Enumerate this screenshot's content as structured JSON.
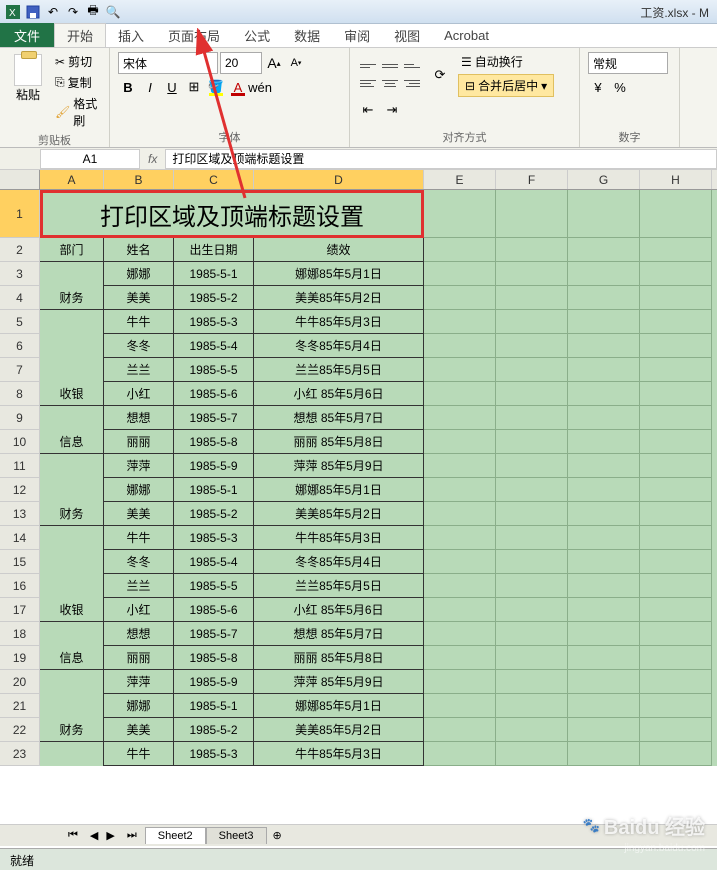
{
  "window": {
    "title": "工资.xlsx - M"
  },
  "qat": {
    "save": "保存",
    "undo": "撤销",
    "redo": "重做"
  },
  "tabs": {
    "file": "文件",
    "items": [
      "开始",
      "插入",
      "页面布局",
      "公式",
      "数据",
      "审阅",
      "视图",
      "Acrobat"
    ],
    "active": 0
  },
  "ribbon": {
    "clipboard": {
      "label": "剪贴板",
      "paste": "粘贴",
      "cut": "剪切",
      "copy": "复制",
      "format": "格式刷"
    },
    "font": {
      "label": "字体",
      "name": "宋体",
      "size": "20",
      "grow": "A",
      "shrink": "A"
    },
    "align": {
      "label": "对齐方式",
      "wrap": "自动换行",
      "merge": "合并后居中"
    },
    "number": {
      "label": "数字",
      "format": "常规"
    }
  },
  "cellref": {
    "name": "A1",
    "formula": "打印区域及顶端标题设置"
  },
  "columns": [
    "A",
    "B",
    "C",
    "D",
    "E",
    "F",
    "G",
    "H"
  ],
  "sheet": {
    "title": "打印区域及顶端标题设置",
    "headers": [
      "部门",
      "姓名",
      "出生日期",
      "绩效"
    ],
    "rows": [
      {
        "n": 3,
        "a": "",
        "b": "娜娜",
        "c": "1985-5-1",
        "d": "娜娜85年5月1日"
      },
      {
        "n": 4,
        "a": "财务",
        "b": "美美",
        "c": "1985-5-2",
        "d": "美美85年5月2日"
      },
      {
        "n": 5,
        "a": "",
        "b": "牛牛",
        "c": "1985-5-3",
        "d": "牛牛85年5月3日"
      },
      {
        "n": 6,
        "a": "",
        "b": "冬冬",
        "c": "1985-5-4",
        "d": "冬冬85年5月4日"
      },
      {
        "n": 7,
        "a": "",
        "b": "兰兰",
        "c": "1985-5-5",
        "d": "兰兰85年5月5日"
      },
      {
        "n": 8,
        "a": "收银",
        "b": "小红",
        "c": "1985-5-6",
        "d": "小红 85年5月6日"
      },
      {
        "n": 9,
        "a": "",
        "b": "想想",
        "c": "1985-5-7",
        "d": "想想 85年5月7日"
      },
      {
        "n": 10,
        "a": "信息",
        "b": "丽丽",
        "c": "1985-5-8",
        "d": "丽丽 85年5月8日"
      },
      {
        "n": 11,
        "a": "",
        "b": "萍萍",
        "c": "1985-5-9",
        "d": "萍萍 85年5月9日"
      },
      {
        "n": 12,
        "a": "",
        "b": "娜娜",
        "c": "1985-5-1",
        "d": "娜娜85年5月1日"
      },
      {
        "n": 13,
        "a": "财务",
        "b": "美美",
        "c": "1985-5-2",
        "d": "美美85年5月2日"
      },
      {
        "n": 14,
        "a": "",
        "b": "牛牛",
        "c": "1985-5-3",
        "d": "牛牛85年5月3日"
      },
      {
        "n": 15,
        "a": "",
        "b": "冬冬",
        "c": "1985-5-4",
        "d": "冬冬85年5月4日"
      },
      {
        "n": 16,
        "a": "",
        "b": "兰兰",
        "c": "1985-5-5",
        "d": "兰兰85年5月5日"
      },
      {
        "n": 17,
        "a": "收银",
        "b": "小红",
        "c": "1985-5-6",
        "d": "小红 85年5月6日"
      },
      {
        "n": 18,
        "a": "",
        "b": "想想",
        "c": "1985-5-7",
        "d": "想想 85年5月7日"
      },
      {
        "n": 19,
        "a": "信息",
        "b": "丽丽",
        "c": "1985-5-8",
        "d": "丽丽 85年5月8日"
      },
      {
        "n": 20,
        "a": "",
        "b": "萍萍",
        "c": "1985-5-9",
        "d": "萍萍 85年5月9日"
      },
      {
        "n": 21,
        "a": "",
        "b": "娜娜",
        "c": "1985-5-1",
        "d": "娜娜85年5月1日"
      },
      {
        "n": 22,
        "a": "财务",
        "b": "美美",
        "c": "1985-5-2",
        "d": "美美85年5月2日"
      },
      {
        "n": 23,
        "a": "",
        "b": "牛牛",
        "c": "1985-5-3",
        "d": "牛牛85年5月3日"
      }
    ]
  },
  "sheetTabs": [
    "Sheet2",
    "Sheet3"
  ],
  "status": "就绪",
  "watermark": {
    "main": "Baidu 经验",
    "sub": "jingyan.baidu.com"
  }
}
